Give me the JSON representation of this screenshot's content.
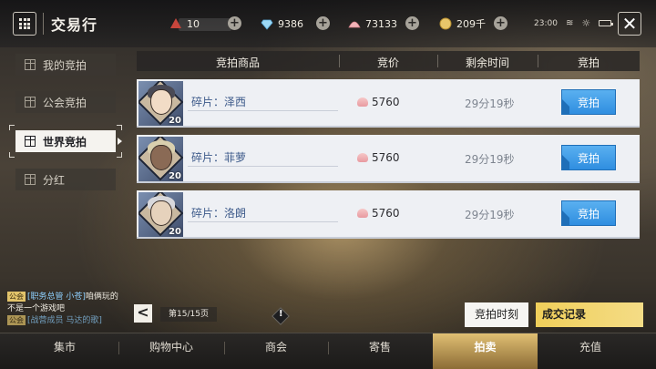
{
  "header": {
    "title": "交易行",
    "resources": [
      {
        "name": "flag-icon",
        "value": "10"
      },
      {
        "name": "diamond-icon",
        "value": "9386"
      },
      {
        "name": "shell-icon",
        "value": "73133"
      },
      {
        "name": "coin-icon",
        "value": "209千"
      }
    ],
    "clock": "23:00"
  },
  "left_nav": {
    "items": [
      {
        "label": "我的竞拍",
        "active": false
      },
      {
        "label": "公会竞拍",
        "active": false
      },
      {
        "label": "世界竞拍",
        "active": true
      },
      {
        "label": "分红",
        "active": false
      }
    ]
  },
  "table": {
    "headers": [
      "竞拍商品",
      "竞价",
      "剩余时间",
      "竞拍"
    ],
    "rows": [
      {
        "name": "碎片：泽西",
        "level": "20",
        "price": "5760",
        "time": "29分19秒",
        "action": "竞拍"
      },
      {
        "name": "碎片：菲萝",
        "level": "20",
        "price": "5760",
        "time": "29分19秒",
        "action": "竞拍"
      },
      {
        "name": "碎片：洛朗",
        "level": "20",
        "price": "5760",
        "time": "29分19秒",
        "action": "竞拍"
      }
    ]
  },
  "chat": {
    "tag1": "公会",
    "who1": "[职务总管 小苍]",
    "msg1": "咱俩玩的不是一个游戏吧",
    "tag2": "公会",
    "msg2": "[战营成员 马达的歌]"
  },
  "pager": {
    "text": "第15/15页",
    "prev": "<"
  },
  "buttons": {
    "auction_time": "竞拍时刻",
    "records": "成交记录"
  },
  "tabs": [
    "集市",
    "购物中心",
    "商会",
    "寄售",
    "拍卖",
    "充值"
  ],
  "colors": {
    "accent_blue": "#3a9ae6",
    "accent_gold": "#f0cf5a",
    "active_nav": "#f5f3ef"
  }
}
